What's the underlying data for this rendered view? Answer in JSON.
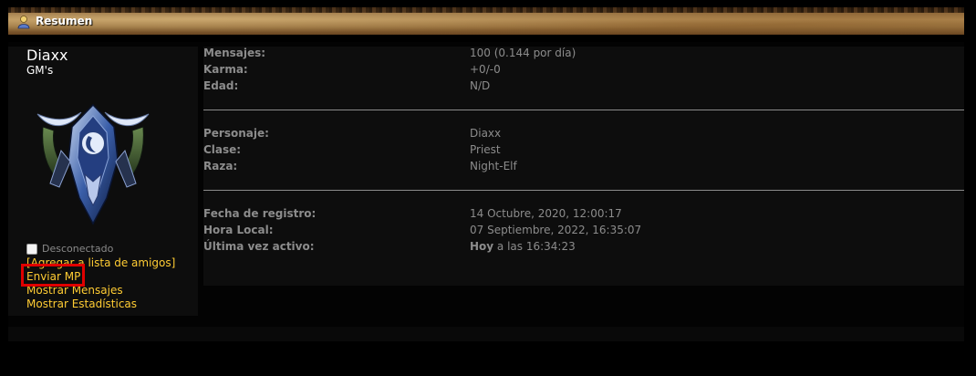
{
  "header": {
    "title": "Resumen",
    "icon": "user-icon"
  },
  "profile": {
    "username": "Diaxx",
    "group": "GM's",
    "status": "Desconectado",
    "links": {
      "add_friend": "[Agregar a lista de amigos]",
      "send_pm": "Enviar MP",
      "show_posts": "Mostrar Mensajes",
      "show_stats": "Mostrar Estadísticas"
    }
  },
  "stats": {
    "messages_label": "Mensajes:",
    "messages_value": "100 (0.144 por día)",
    "karma_label": "Karma:",
    "karma_value": "+0/-0",
    "age_label": "Edad:",
    "age_value": "N/D",
    "character_label": "Personaje:",
    "character_value": "Diaxx",
    "class_label": "Clase:",
    "class_value": "Priest",
    "race_label": "Raza:",
    "race_value": "Night-Elf",
    "registered_label": "Fecha de registro:",
    "registered_value": "14 Octubre, 2020, 12:00:17",
    "local_time_label": "Hora Local:",
    "local_time_value": "07 Septiembre, 2022, 16:35:07",
    "last_active_label": "Última vez activo:",
    "last_active_day": "Hoy",
    "last_active_time": " a las 16:34:23"
  },
  "colors": {
    "link": "#ffcc33",
    "label": "#8c8c8c",
    "highlight": "#e00000"
  }
}
